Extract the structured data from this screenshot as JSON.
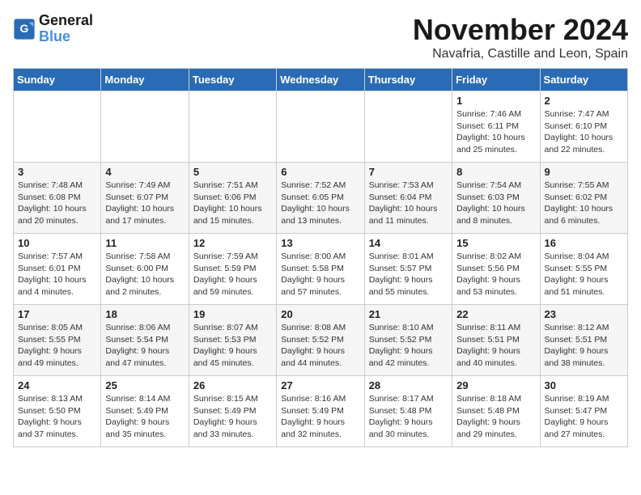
{
  "logo": {
    "line1": "General",
    "line2": "Blue"
  },
  "title": "November 2024",
  "location": "Navafria, Castille and Leon, Spain",
  "headers": [
    "Sunday",
    "Monday",
    "Tuesday",
    "Wednesday",
    "Thursday",
    "Friday",
    "Saturday"
  ],
  "weeks": [
    [
      {
        "day": "",
        "info": ""
      },
      {
        "day": "",
        "info": ""
      },
      {
        "day": "",
        "info": ""
      },
      {
        "day": "",
        "info": ""
      },
      {
        "day": "",
        "info": ""
      },
      {
        "day": "1",
        "info": "Sunrise: 7:46 AM\nSunset: 6:11 PM\nDaylight: 10 hours\nand 25 minutes."
      },
      {
        "day": "2",
        "info": "Sunrise: 7:47 AM\nSunset: 6:10 PM\nDaylight: 10 hours\nand 22 minutes."
      }
    ],
    [
      {
        "day": "3",
        "info": "Sunrise: 7:48 AM\nSunset: 6:08 PM\nDaylight: 10 hours\nand 20 minutes."
      },
      {
        "day": "4",
        "info": "Sunrise: 7:49 AM\nSunset: 6:07 PM\nDaylight: 10 hours\nand 17 minutes."
      },
      {
        "day": "5",
        "info": "Sunrise: 7:51 AM\nSunset: 6:06 PM\nDaylight: 10 hours\nand 15 minutes."
      },
      {
        "day": "6",
        "info": "Sunrise: 7:52 AM\nSunset: 6:05 PM\nDaylight: 10 hours\nand 13 minutes."
      },
      {
        "day": "7",
        "info": "Sunrise: 7:53 AM\nSunset: 6:04 PM\nDaylight: 10 hours\nand 11 minutes."
      },
      {
        "day": "8",
        "info": "Sunrise: 7:54 AM\nSunset: 6:03 PM\nDaylight: 10 hours\nand 8 minutes."
      },
      {
        "day": "9",
        "info": "Sunrise: 7:55 AM\nSunset: 6:02 PM\nDaylight: 10 hours\nand 6 minutes."
      }
    ],
    [
      {
        "day": "10",
        "info": "Sunrise: 7:57 AM\nSunset: 6:01 PM\nDaylight: 10 hours\nand 4 minutes."
      },
      {
        "day": "11",
        "info": "Sunrise: 7:58 AM\nSunset: 6:00 PM\nDaylight: 10 hours\nand 2 minutes."
      },
      {
        "day": "12",
        "info": "Sunrise: 7:59 AM\nSunset: 5:59 PM\nDaylight: 9 hours\nand 59 minutes."
      },
      {
        "day": "13",
        "info": "Sunrise: 8:00 AM\nSunset: 5:58 PM\nDaylight: 9 hours\nand 57 minutes."
      },
      {
        "day": "14",
        "info": "Sunrise: 8:01 AM\nSunset: 5:57 PM\nDaylight: 9 hours\nand 55 minutes."
      },
      {
        "day": "15",
        "info": "Sunrise: 8:02 AM\nSunset: 5:56 PM\nDaylight: 9 hours\nand 53 minutes."
      },
      {
        "day": "16",
        "info": "Sunrise: 8:04 AM\nSunset: 5:55 PM\nDaylight: 9 hours\nand 51 minutes."
      }
    ],
    [
      {
        "day": "17",
        "info": "Sunrise: 8:05 AM\nSunset: 5:55 PM\nDaylight: 9 hours\nand 49 minutes."
      },
      {
        "day": "18",
        "info": "Sunrise: 8:06 AM\nSunset: 5:54 PM\nDaylight: 9 hours\nand 47 minutes."
      },
      {
        "day": "19",
        "info": "Sunrise: 8:07 AM\nSunset: 5:53 PM\nDaylight: 9 hours\nand 45 minutes."
      },
      {
        "day": "20",
        "info": "Sunrise: 8:08 AM\nSunset: 5:52 PM\nDaylight: 9 hours\nand 44 minutes."
      },
      {
        "day": "21",
        "info": "Sunrise: 8:10 AM\nSunset: 5:52 PM\nDaylight: 9 hours\nand 42 minutes."
      },
      {
        "day": "22",
        "info": "Sunrise: 8:11 AM\nSunset: 5:51 PM\nDaylight: 9 hours\nand 40 minutes."
      },
      {
        "day": "23",
        "info": "Sunrise: 8:12 AM\nSunset: 5:51 PM\nDaylight: 9 hours\nand 38 minutes."
      }
    ],
    [
      {
        "day": "24",
        "info": "Sunrise: 8:13 AM\nSunset: 5:50 PM\nDaylight: 9 hours\nand 37 minutes."
      },
      {
        "day": "25",
        "info": "Sunrise: 8:14 AM\nSunset: 5:49 PM\nDaylight: 9 hours\nand 35 minutes."
      },
      {
        "day": "26",
        "info": "Sunrise: 8:15 AM\nSunset: 5:49 PM\nDaylight: 9 hours\nand 33 minutes."
      },
      {
        "day": "27",
        "info": "Sunrise: 8:16 AM\nSunset: 5:49 PM\nDaylight: 9 hours\nand 32 minutes."
      },
      {
        "day": "28",
        "info": "Sunrise: 8:17 AM\nSunset: 5:48 PM\nDaylight: 9 hours\nand 30 minutes."
      },
      {
        "day": "29",
        "info": "Sunrise: 8:18 AM\nSunset: 5:48 PM\nDaylight: 9 hours\nand 29 minutes."
      },
      {
        "day": "30",
        "info": "Sunrise: 8:19 AM\nSunset: 5:47 PM\nDaylight: 9 hours\nand 27 minutes."
      }
    ]
  ]
}
